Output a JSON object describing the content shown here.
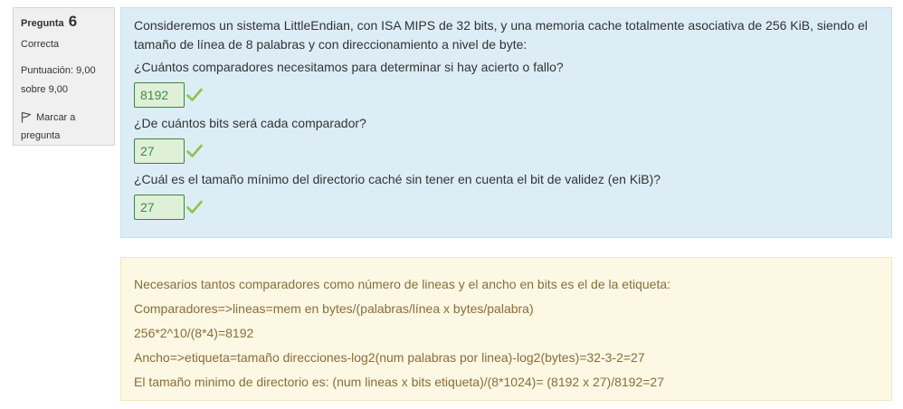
{
  "info": {
    "question_label": "Pregunta",
    "question_number": "6",
    "state": "Correcta",
    "grade_line1": "Puntuación: 9,00",
    "grade_line2": "sobre 9,00",
    "flag_line1": "Marcar a",
    "flag_line2": "pregunta"
  },
  "formulation": {
    "text": "Consideremos un sistema LittleEndian, con ISA MIPS de 32 bits, y una memoria cache totalmente asociativa de 256 KiB, siendo el tamaño de línea de 8 palabras y con direccionamiento a nivel de byte:",
    "subquestions": [
      {
        "prompt": "¿Cuántos comparadores necesitamos para determinar si hay acierto o fallo?",
        "answer": "8192"
      },
      {
        "prompt": "¿De cuántos bits será cada comparador?",
        "answer": "27"
      },
      {
        "prompt": "¿Cuál es el tamaño mínimo del directorio caché sin tener en cuenta el bit de validez (en KiB)?",
        "answer": "27"
      }
    ]
  },
  "feedback": {
    "lines": [
      "Necesarios tantos comparadores como número de lineas y el ancho en bits es el de la etiqueta:",
      "Comparadores=>lineas=mem en bytes/(palabras/línea x bytes/palabra)",
      "256*2^10/(8*4)=8192",
      "Ancho=>etiqueta=tamaño direcciones-log2(num palabras por linea)-log2(bytes)=32-3-2=27",
      "El tamaño minimo de directorio es: (num lineas x bits etiqueta)/(8*1024)= (8192 x 27)/8192=27"
    ]
  },
  "colors": {
    "correct_green": "#8bc34a",
    "info_bg": "#dcedf6",
    "feedback_bg": "#fcf8e3"
  }
}
